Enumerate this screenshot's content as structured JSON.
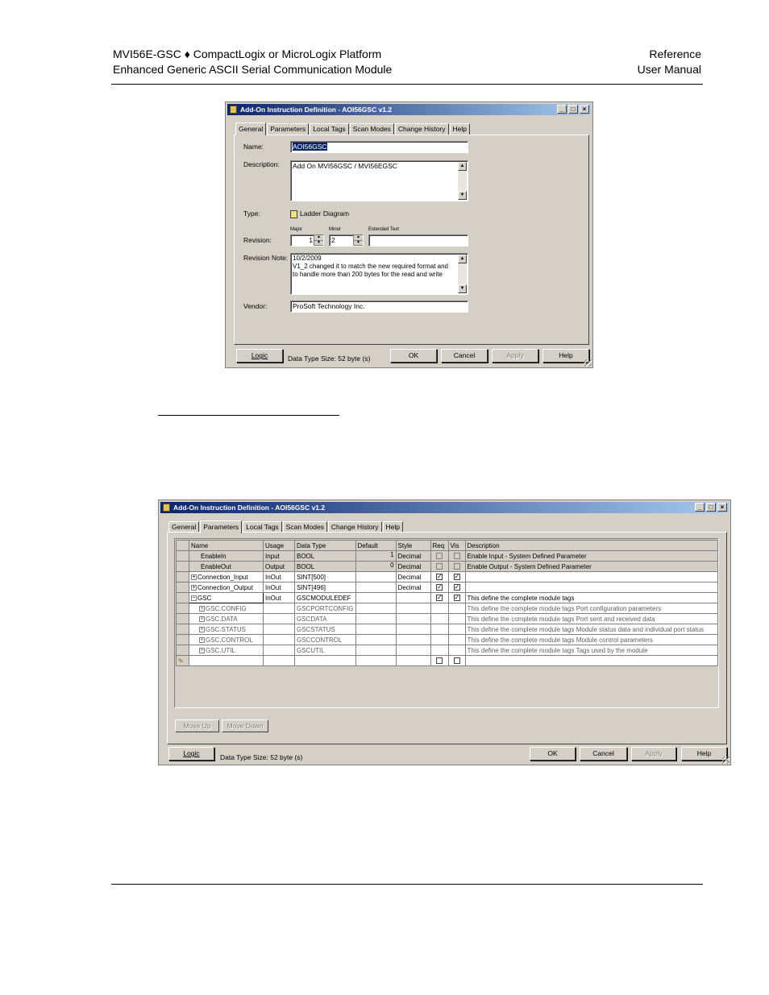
{
  "header": {
    "left_line1": "MVI56E-GSC ♦ CompactLogix or MicroLogix Platform",
    "left_line2": "Enhanced Generic ASCII Serial Communication Module",
    "right_line1": "Reference",
    "right_line2": "User Manual"
  },
  "dialog1": {
    "title": "Add-On Instruction Definition - AOI56GSC v1.2",
    "tabs": [
      "General",
      "Parameters",
      "Local Tags",
      "Scan Modes",
      "Change History",
      "Help"
    ],
    "name_label": "Name:",
    "name_value": "AOI56GSC",
    "description_label": "Description:",
    "description_value": "Add On MVI56GSC / MVI56EGSC",
    "type_label": "Type:",
    "type_value": "Ladder Diagram",
    "major_label": "Major",
    "minor_label": "Minor",
    "extended_label": "Extended Text",
    "revision_label": "Revision:",
    "major_value": "1",
    "minor_value": "2",
    "revision_note_label": "Revision Note:",
    "revision_note_lines": [
      "10/2/2009",
      "V1_2 changed it to match the new required format and",
      "to handle more than 200 bytes for the read and write"
    ],
    "vendor_label": "Vendor:",
    "vendor_value": "ProSoft Technology Inc.",
    "logic_button": "Logic",
    "data_type_size": "Data Type Size: 52 byte (s)",
    "ok_button": "OK",
    "cancel_button": "Cancel",
    "apply_button": "Apply",
    "help_button": "Help"
  },
  "dialog2": {
    "title": "Add-On Instruction Definition - AOI56GSC v1.2",
    "tabs": [
      "General",
      "Parameters",
      "Local Tags",
      "Scan Modes",
      "Change History",
      "Help"
    ],
    "columns": [
      "Name",
      "Usage",
      "Data Type",
      "Default",
      "Style",
      "Req",
      "Vis",
      "Description"
    ],
    "rows": [
      {
        "name": "EnableIn",
        "usage": "Input",
        "data_type": "BOOL",
        "default": "1",
        "style": "Decimal",
        "req": false,
        "vis": false,
        "description": "Enable Input - System Defined Parameter"
      },
      {
        "name": "EnableOut",
        "usage": "Output",
        "data_type": "BOOL",
        "default": "0",
        "style": "Decimal",
        "req": false,
        "vis": false,
        "description": "Enable Output - System Defined Parameter"
      },
      {
        "name": "Connection_Input",
        "usage": "InOut",
        "data_type": "SINT[500]",
        "default": "",
        "style": "Decimal",
        "req": true,
        "vis": true,
        "description": ""
      },
      {
        "name": "Connection_Output",
        "usage": "InOut",
        "data_type": "SINT[496]",
        "default": "",
        "style": "Decimal",
        "req": true,
        "vis": true,
        "description": ""
      },
      {
        "name": "GSC",
        "usage": "InOut",
        "data_type": "GSCMODULEDEF",
        "default": "",
        "style": "",
        "req": true,
        "vis": true,
        "description": "This define the complete module tags"
      },
      {
        "name": "GSC.CONFIG",
        "usage": "",
        "data_type": "GSCPORTCONFIG",
        "default": "",
        "style": "",
        "description": "This define the complete module tags  Port configuration parameters"
      },
      {
        "name": "GSC.DATA",
        "usage": "",
        "data_type": "GSCDATA",
        "default": "",
        "style": "",
        "description": "This define the complete module tags  Port sent and received data"
      },
      {
        "name": "GSC.STATUS",
        "usage": "",
        "data_type": "GSCSTATUS",
        "default": "",
        "style": "",
        "description": "This define the complete module tags  Module status data and individual port status"
      },
      {
        "name": "GSC.CONTROL",
        "usage": "",
        "data_type": "GSCCONTROL",
        "default": "",
        "style": "",
        "description": "This define the complete module tags  Module control parameters"
      },
      {
        "name": "GSC.UTIL",
        "usage": "",
        "data_type": "GSCUTIL",
        "default": "",
        "style": "",
        "description": "This define the complete module tags  Tags used by the module"
      }
    ],
    "move_up_button": "Move Up",
    "move_down_button": "Move Down",
    "logic_button": "Logic",
    "data_type_size": "Data Type Size: 52 byte (s)",
    "ok_button": "OK",
    "cancel_button": "Cancel",
    "apply_button": "Apply",
    "help_button": "Help"
  },
  "colors": {
    "titlebar_start": "#0a246a",
    "titlebar_end": "#a6caf0",
    "dialog_face": "#d4d0c8"
  }
}
